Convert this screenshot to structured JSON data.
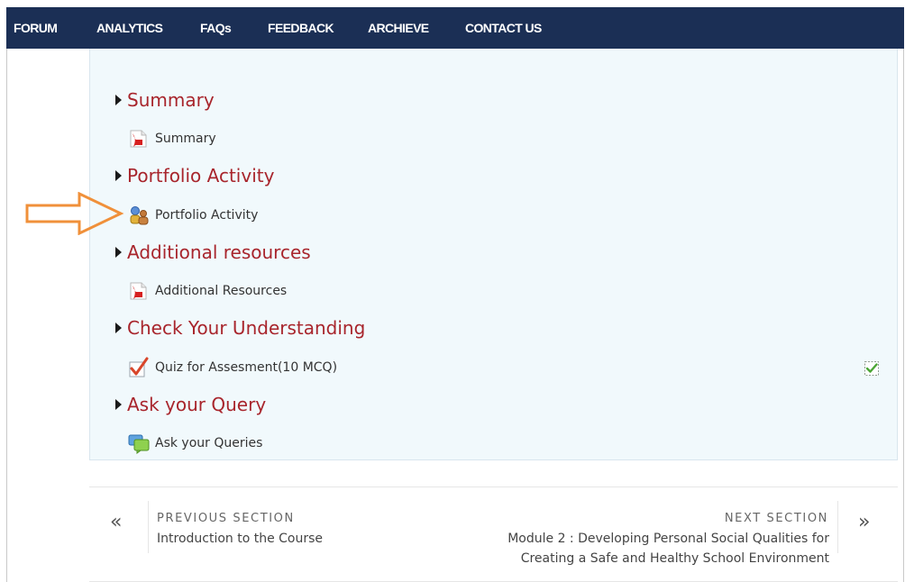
{
  "nav": {
    "items": [
      "FORUM",
      "ANALYTICS",
      "FAQs",
      "FEEDBACK",
      "ARCHIEVE",
      "CONTACT US"
    ]
  },
  "sections": [
    {
      "title": "Summary",
      "activity": "Summary",
      "activity_icon": "pdf-icon"
    },
    {
      "title": "Portfolio Activity",
      "activity": "Portfolio Activity",
      "activity_icon": "portfolio-users-icon"
    },
    {
      "title": "Additional resources",
      "activity": "Additional Resources",
      "activity_icon": "pdf-icon"
    },
    {
      "title": "Check Your Understanding",
      "activity": "Quiz for Assesment(10 MCQ)",
      "activity_icon": "quiz-checkmark-icon"
    },
    {
      "title": "Ask your Query",
      "activity": "Ask your Queries",
      "activity_icon": "chat-bubbles-icon"
    }
  ],
  "section_nav": {
    "prev_caption": "PREVIOUS SECTION",
    "prev_title": "Introduction to the Course",
    "next_caption": "NEXT SECTION",
    "next_title_line1": "Module 2 : Developing Personal Social Qualities for",
    "next_title_line2": "Creating a Safe and Healthy School Environment",
    "prev_symbol": "«",
    "next_symbol": "»"
  },
  "colors": {
    "nav_bg": "#1b2f55",
    "section_title": "#a8252c",
    "panel_bg": "#f1f9fc",
    "arrow_annotation": "#f0903a"
  }
}
